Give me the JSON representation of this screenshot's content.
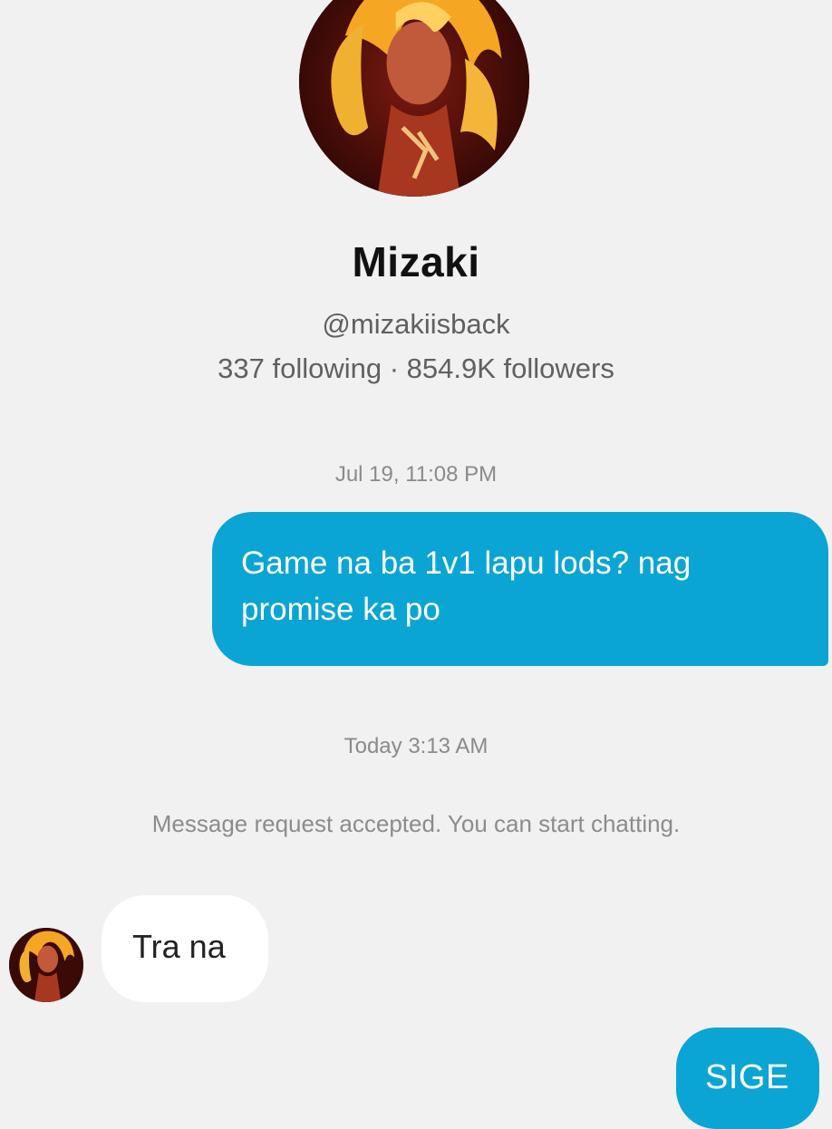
{
  "profile": {
    "name": "Mizaki",
    "handle": "@mizakiisback",
    "stats": "337 following · 854.9K followers",
    "avatar_icon": "anime-character-avatar"
  },
  "conversation": {
    "timestamp_1": "Jul 19, 11:08 PM",
    "sent_message_1": "Game na ba 1v1 lapu lods? nag promise ka po",
    "timestamp_2": "Today 3:13 AM",
    "system_note": "Message request accepted. You can start chatting.",
    "received_message_1": "Tra na",
    "sent_message_2": "SIGE"
  },
  "colors": {
    "background": "#f1f1f1",
    "sent_bubble": "#0aa5d4",
    "received_bubble": "#ffffff"
  }
}
